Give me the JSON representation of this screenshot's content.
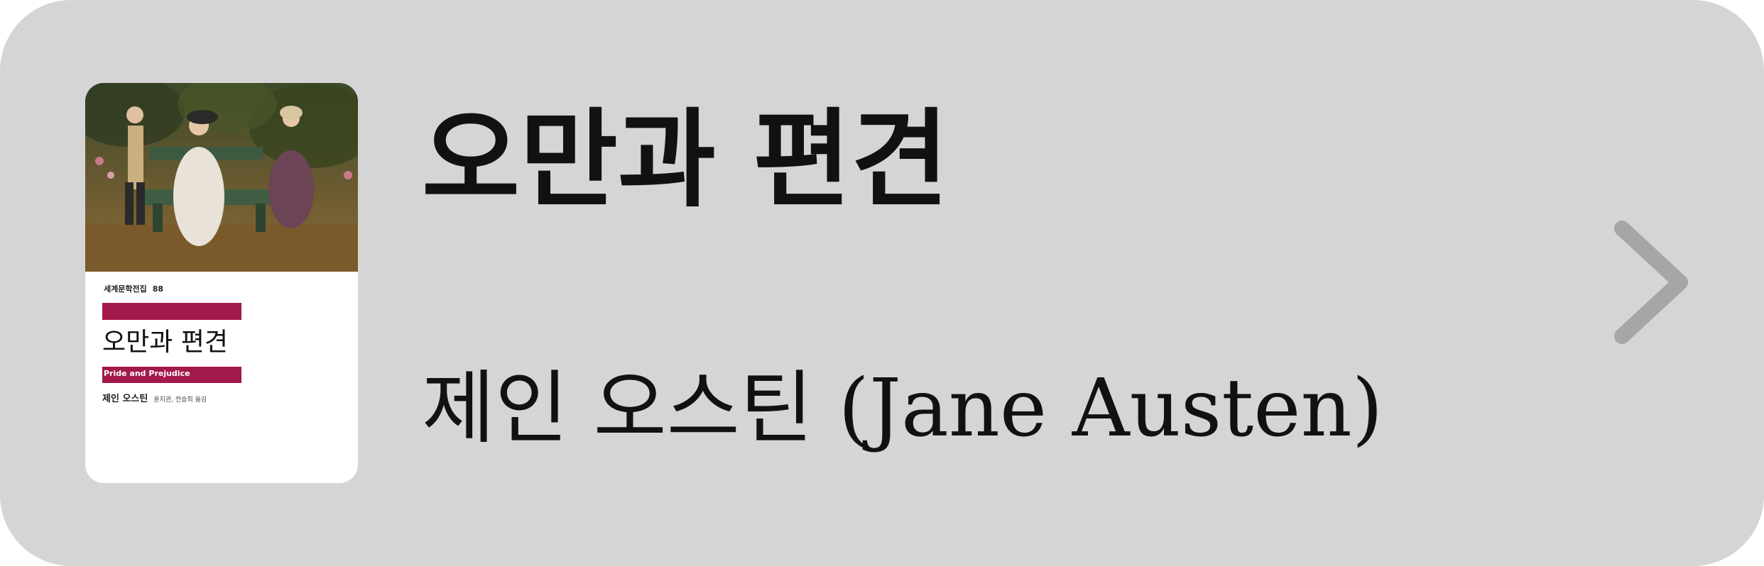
{
  "book": {
    "title": "오만과 편견",
    "author": "제인 오스틴 (Jane Austen)",
    "cover": {
      "series": "세계문학전집",
      "series_number": "88",
      "title": "오만과 편견",
      "subtitle": "Pride and Prejudice",
      "author": "제인 오스틴",
      "translators": "윤지관, 전승희 옮김"
    }
  },
  "icons": {
    "next": "chevron-right-icon"
  },
  "colors": {
    "card_background": "#d5d5d5",
    "text": "#111111",
    "chevron": "#a6a6a6",
    "cover_accent": "#a3184a"
  }
}
